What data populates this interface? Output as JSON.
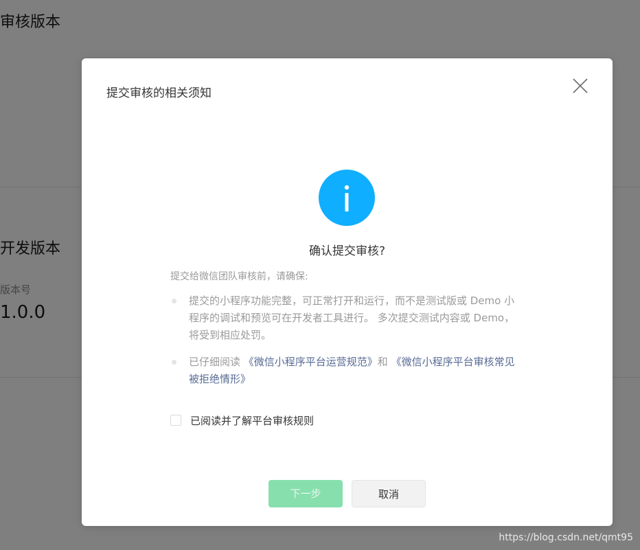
{
  "background": {
    "review_section_title": "审核版本",
    "dev_section_title": "开发版本",
    "version_label": "版本号",
    "version_value": "1.0.0"
  },
  "dialog": {
    "title": "提交审核的相关须知",
    "close_icon": "close-icon",
    "status_icon": "info-icon",
    "confirm_title": "确认提交审核?",
    "intro": "提交给微信团队审核前，请确保:",
    "rules": [
      {
        "text": "提交的小程序功能完整，可正常打开和运行，而不是测试版或 Demo 小程序的调试和预览可在开发者工具进行。 多次提交测试内容或 Demo，将受到相应处罚。"
      },
      {
        "prefix": "已仔细阅读 ",
        "link1": "《微信小程序平台运营规范》",
        "connector": "和 ",
        "link2": "《微信小程序平台审核常见被拒绝情形》"
      }
    ],
    "agree_label": "已阅读并了解平台审核规则",
    "agree_checked": false,
    "next_button": "下一步",
    "cancel_button": "取消"
  },
  "watermark": "https://blog.csdn.net/qmt95",
  "colors": {
    "info_icon": "#10aeff",
    "link": "#576b95",
    "next_button_disabled": "#87dfae"
  }
}
